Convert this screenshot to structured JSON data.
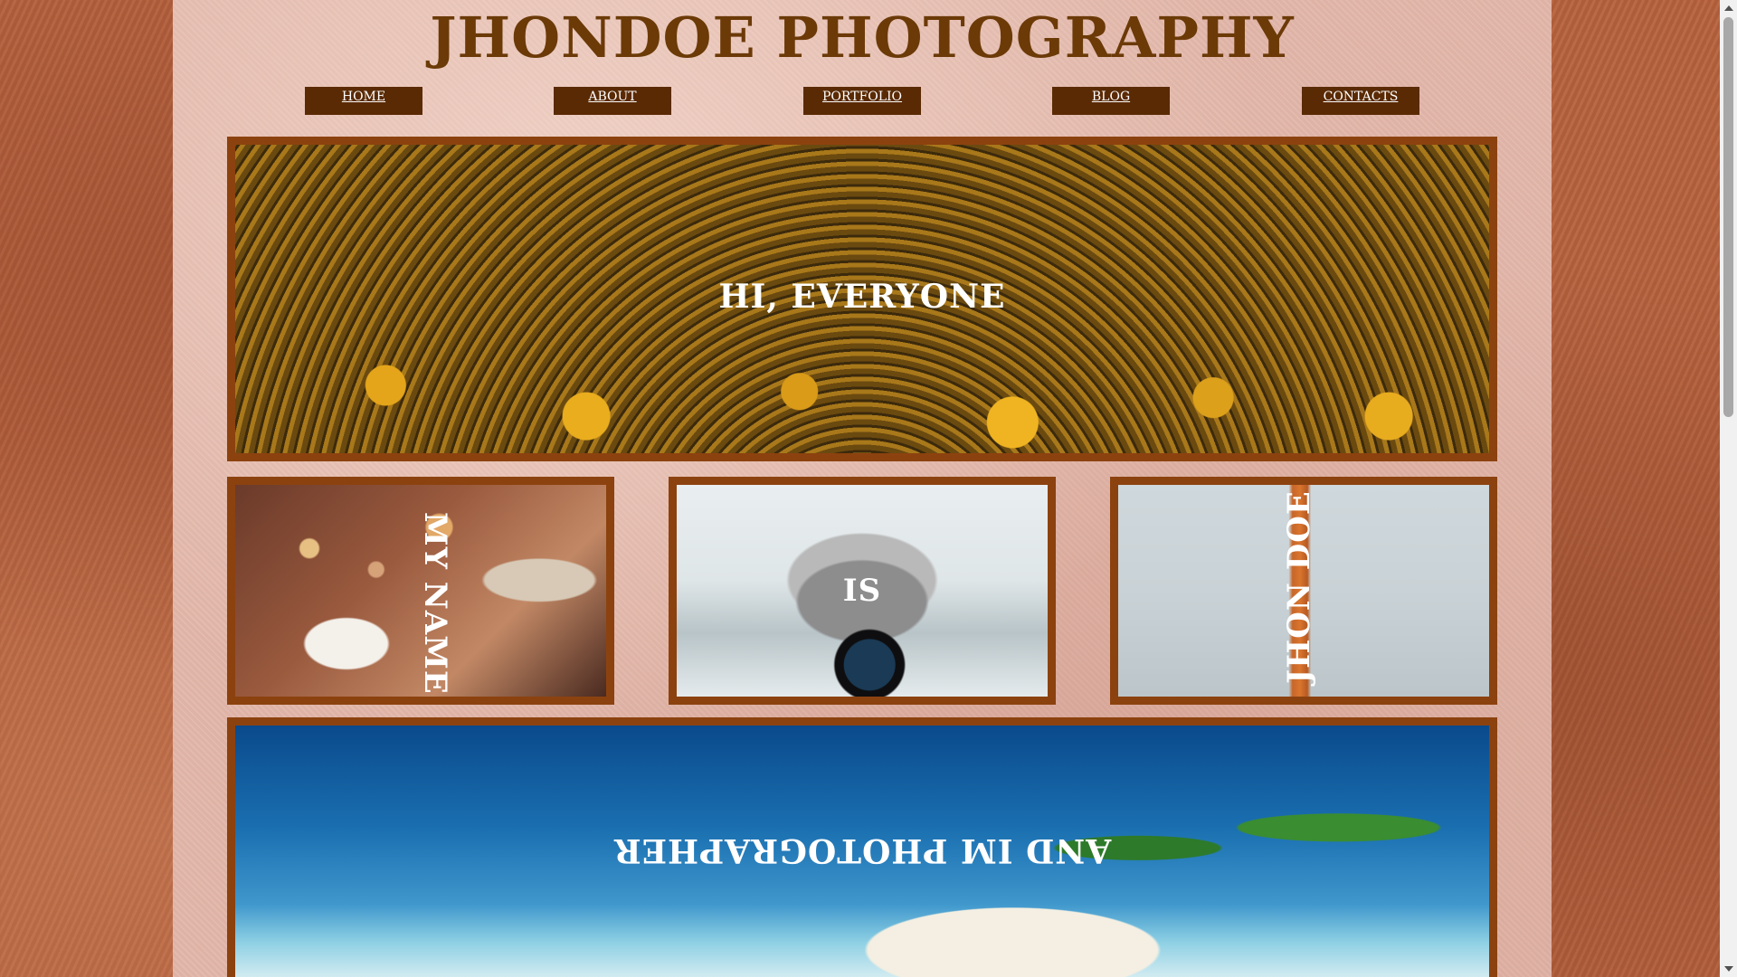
{
  "site": {
    "title": "JHONDOE PHOTOGRAPHY"
  },
  "nav": {
    "items": [
      {
        "label": "HOME"
      },
      {
        "label": "ABOUT"
      },
      {
        "label": "PORTFOLIO"
      },
      {
        "label": "BLOG"
      },
      {
        "label": "CONTACTS"
      }
    ]
  },
  "hero": {
    "text": "HI, EVERYONE",
    "image": "sunflower-field-sunset-photo"
  },
  "cards": [
    {
      "text": "MY NAME",
      "image": "photographer-with-dog-photo"
    },
    {
      "text": "IS",
      "image": "snowy-photographer-nikon-photo"
    },
    {
      "text": "JHON DOE",
      "image": "eiffel-tower-photo"
    }
  ],
  "bottom": {
    "text": "AND IM PHOTOGRAPHER",
    "image": "tropical-beach-palms-photo"
  },
  "colors": {
    "title": "#6b3a07",
    "nav_button": "#5a2a04",
    "frame": "#8c420f",
    "page_bg": "#e2b7aa",
    "outer_bg": "#b5623f"
  },
  "icons": {
    "scroll_up": "triangle-up-icon",
    "scroll_down": "triangle-down-icon"
  }
}
